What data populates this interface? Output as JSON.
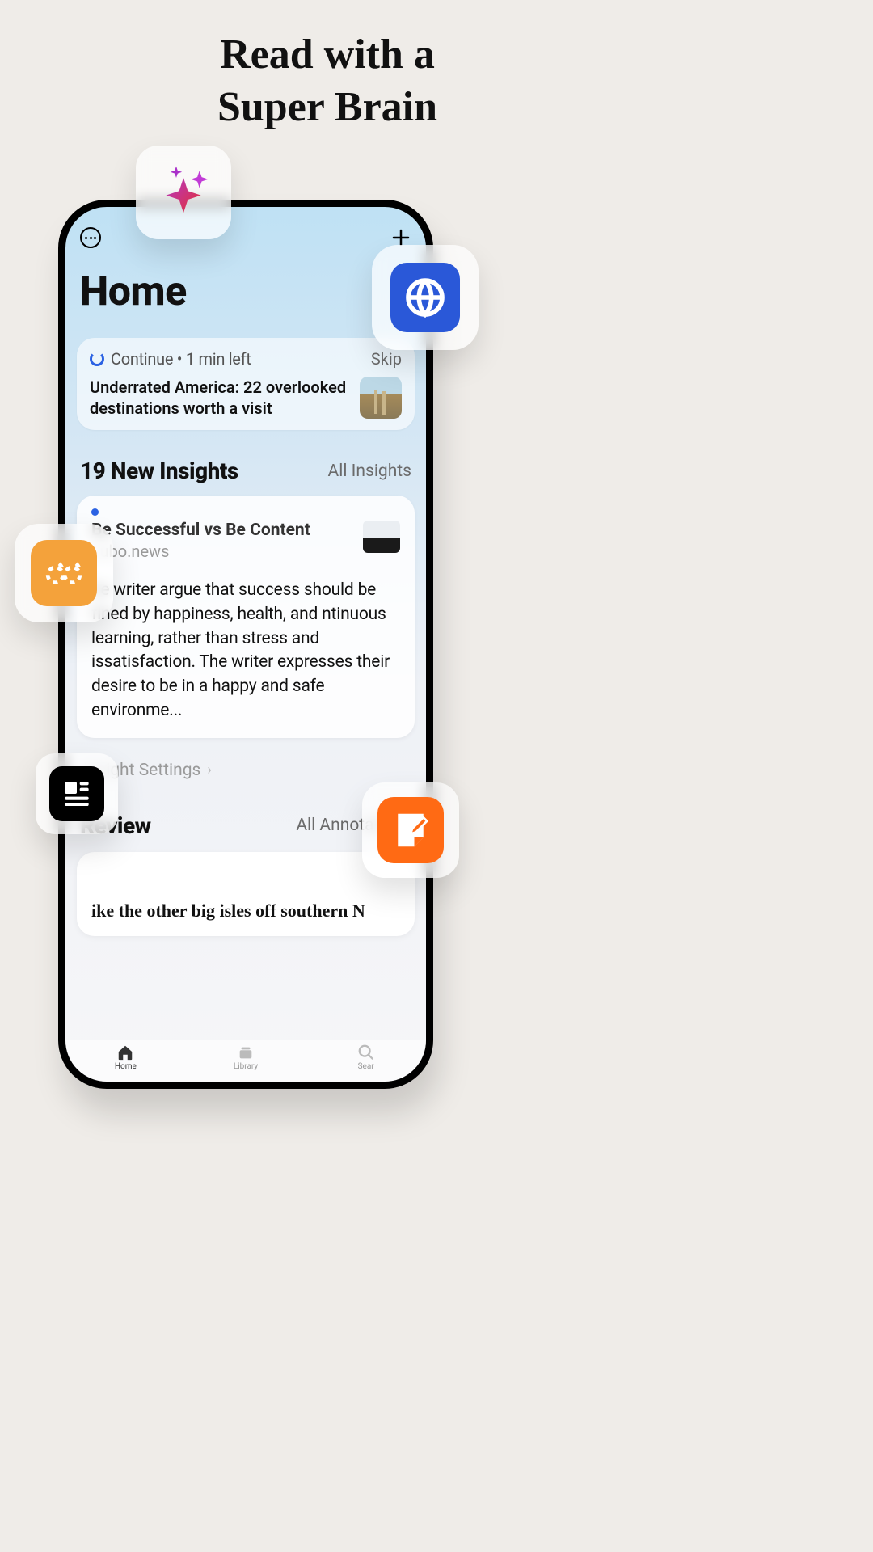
{
  "headline": {
    "line1": "Read with a",
    "line2": "Super Brain"
  },
  "page": {
    "title": "Home"
  },
  "continue": {
    "label": "Continue • 1 min left",
    "skip": "Skip",
    "article_title": "Underrated America: 22 overlooked destinations worth a visit"
  },
  "insights": {
    "section_title": "19 New Insights",
    "all_link": "All Insights",
    "card": {
      "title": "Be Successful vs Be Content",
      "source": "cubo.news",
      "body": "he writer argue that success should be fined by happiness, health, and ntinuous learning, rather than stress and issatisfaction. The writer expresses their desire to be in a happy and safe environme..."
    },
    "settings_label": "Insight Settings"
  },
  "review": {
    "section_title": "Review",
    "all_link": "All Annotations",
    "snippet": "ike the other big isles off southern N"
  },
  "tabs": {
    "home": "Home",
    "library": "Library",
    "search": "Sear"
  },
  "float_icons": {
    "sparkle": "sparkle-icon",
    "globe": "globe-icon",
    "quote": "quote-icon",
    "news": "news-icon",
    "note": "note-icon"
  },
  "colors": {
    "accent_blue": "#2b62e3",
    "globe_blue": "#2a58d8",
    "quote_orange": "#f4a23b",
    "note_orange": "#ff6a14"
  }
}
